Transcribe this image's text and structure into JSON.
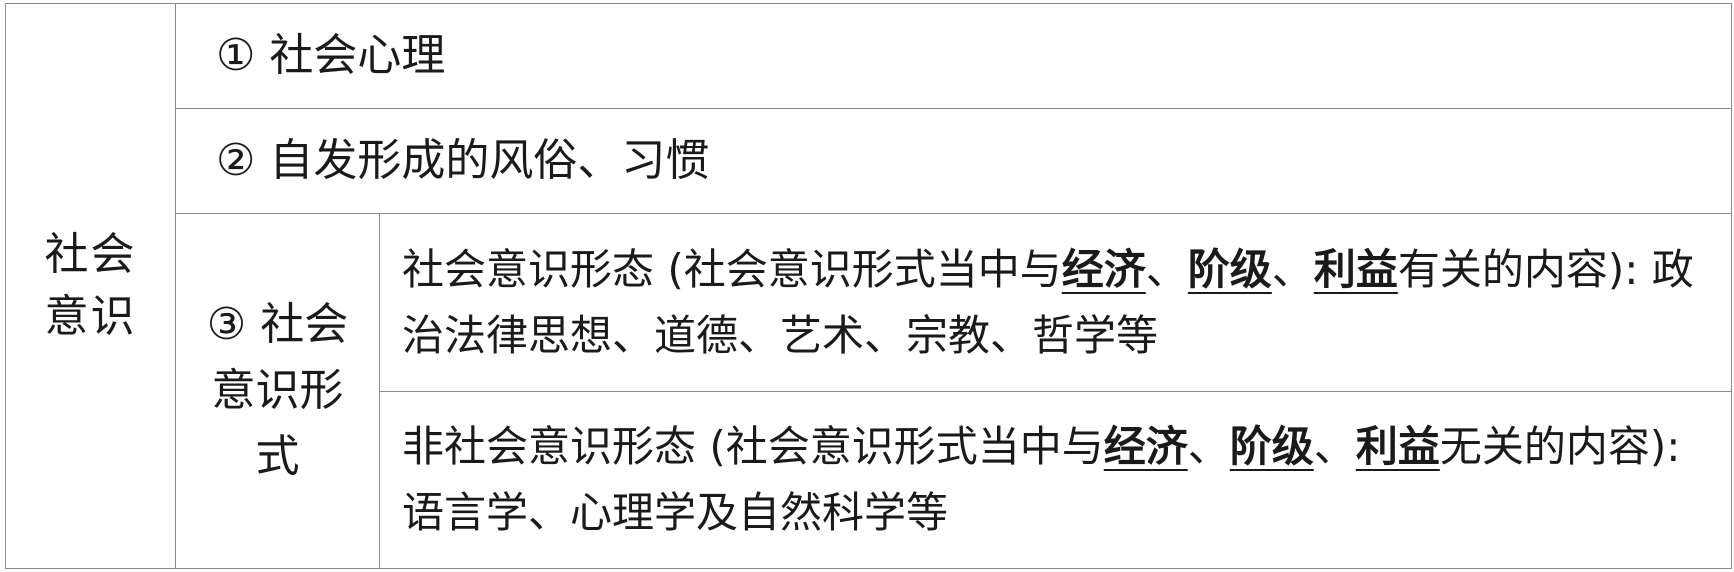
{
  "table": {
    "root_label": "社会意识",
    "rows": [
      {
        "label": "① 社会心理"
      },
      {
        "label": "② 自发形成的风俗、习惯"
      }
    ],
    "forms": {
      "label": "③ 社会意识形式",
      "ideology": {
        "lead": "社会意识形态 (社会意识形式当中与",
        "key1": "经济",
        "sep1": "、",
        "key2": "阶级",
        "sep2": "、",
        "key3": "利益",
        "tail": "有关的内容): 政治法律思想、道德、艺术、宗教、哲学等"
      },
      "non_ideology": {
        "lead": "非社会意识形态 (社会意识形式当中与",
        "key1": "经济",
        "sep1": "、",
        "key2": "阶级",
        "sep2": "、",
        "key3": "利益",
        "tail": "无关的内容): 语言学、心理学及自然科学等"
      }
    }
  }
}
